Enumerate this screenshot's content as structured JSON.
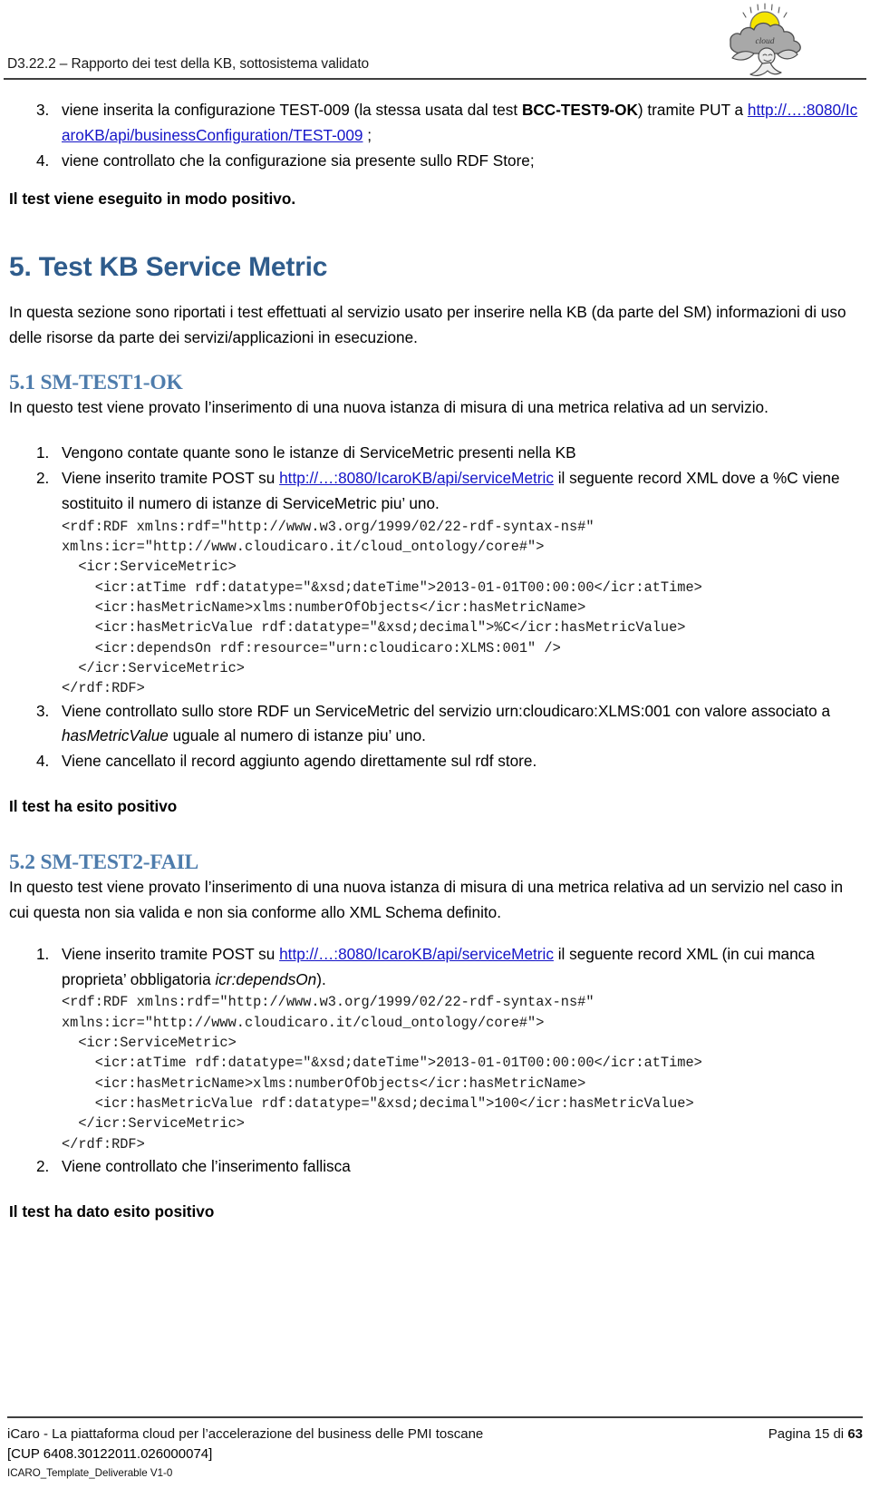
{
  "header": {
    "title": "D3.22.2 – Rapporto dei test della KB, sottosistema validato",
    "logo_name": "icaro-cloud-logo",
    "logo_word": "cloud"
  },
  "top_list": {
    "items": [
      {
        "marker": "3.",
        "text_before_bold": "viene inserita la configurazione TEST-009 (la stessa usata dal test ",
        "bold": "BCC-TEST9-OK",
        "text_after_bold": ") tramite PUT a ",
        "link": "http://…:8080/IcaroKB/api/businessConfiguration/TEST-009",
        "text_end": " ;"
      },
      {
        "marker": "4.",
        "text": "viene controllato che la configurazione sia presente sullo RDF Store;"
      }
    ]
  },
  "result_top": "Il test viene eseguito in modo positivo.",
  "section5": {
    "heading": "5. Test KB Service Metric",
    "intro": "In questa sezione sono riportati i test effettuati al servizio usato per inserire nella KB (da parte del SM) informazioni di uso delle risorse da parte dei servizi/applicazioni in esecuzione."
  },
  "section51": {
    "heading": "5.1 SM-TEST1-OK",
    "intro": "In questo test viene provato l’inserimento di una nuova istanza di misura di una metrica relativa ad un servizio.",
    "items": [
      {
        "marker": "1.",
        "text": "Vengono contate quante sono le istanze di ServiceMetric presenti nella KB"
      },
      {
        "marker": "2.",
        "text_before_link": "Viene inserito tramite POST su ",
        "link": "http://…:8080/IcaroKB/api/serviceMetric",
        "text_after_link": " il seguente record XML dove a %C viene sostituito il numero di istanze di ServiceMetric piu’ uno."
      },
      {
        "marker": "3.",
        "text_before_ital": "Viene controllato sullo store RDF un ServiceMetric del servizio urn:cloudicaro:XLMS:001 con valore associato a ",
        "ital": "hasMetricValue",
        "text_after_ital": " uguale al numero di istanze piu’ uno."
      },
      {
        "marker": "4.",
        "text": "Viene cancellato il record aggiunto agendo direttamente sul rdf store."
      }
    ],
    "code": "<rdf:RDF xmlns:rdf=\"http://www.w3.org/1999/02/22-rdf-syntax-ns#\"\nxmlns:icr=\"http://www.cloudicaro.it/cloud_ontology/core#\">\n  <icr:ServiceMetric>\n    <icr:atTime rdf:datatype=\"&xsd;dateTime\">2013-01-01T00:00:00</icr:atTime>\n    <icr:hasMetricName>xlms:numberOfObjects</icr:hasMetricName>\n    <icr:hasMetricValue rdf:datatype=\"&xsd;decimal\">%C</icr:hasMetricValue>\n    <icr:dependsOn rdf:resource=\"urn:cloudicaro:XLMS:001\" />\n  </icr:ServiceMetric>\n</rdf:RDF>",
    "result": "Il test ha esito positivo"
  },
  "section52": {
    "heading": "5.2 SM-TEST2-FAIL",
    "intro": "In questo test viene provato l’inserimento di una nuova istanza di misura di una metrica relativa ad un servizio nel caso in cui questa non sia valida e non sia conforme allo XML Schema definito.",
    "items": [
      {
        "marker": "1.",
        "text_before_link": "Viene inserito tramite POST su ",
        "link": "http://…:8080/IcaroKB/api/serviceMetric",
        "text_after_link": " il seguente record XML (in cui manca proprieta’ obbligatoria ",
        "ital": "icr:dependsOn",
        "text_end": ")."
      },
      {
        "marker": "2.",
        "text": "Viene controllato che l’inserimento fallisca"
      }
    ],
    "code": "<rdf:RDF xmlns:rdf=\"http://www.w3.org/1999/02/22-rdf-syntax-ns#\"\nxmlns:icr=\"http://www.cloudicaro.it/cloud_ontology/core#\">\n  <icr:ServiceMetric>\n    <icr:atTime rdf:datatype=\"&xsd;dateTime\">2013-01-01T00:00:00</icr:atTime>\n    <icr:hasMetricName>xlms:numberOfObjects</icr:hasMetricName>\n    <icr:hasMetricValue rdf:datatype=\"&xsd;decimal\">100</icr:hasMetricValue>\n  </icr:ServiceMetric>\n</rdf:RDF>",
    "result": "Il test ha dato esito positivo"
  },
  "footer": {
    "left_line1": "iCaro - La piattaforma cloud per l’accelerazione del business delle PMI toscane",
    "left_line2": "[CUP 6408.30122011.026000074]",
    "left_line3": "ICARO_Template_Deliverable V1-0",
    "page_prefix": "Pagina 15 di ",
    "page_total": "63"
  },
  "colors": {
    "heading_blue": "#2f5c8c",
    "subheading_blue": "#4e7cac",
    "link_blue": "#1515c8",
    "rule_gray": "#3f3f3f",
    "logo_sun": "#f5e400",
    "logo_cloud": "#9b9b9b"
  }
}
